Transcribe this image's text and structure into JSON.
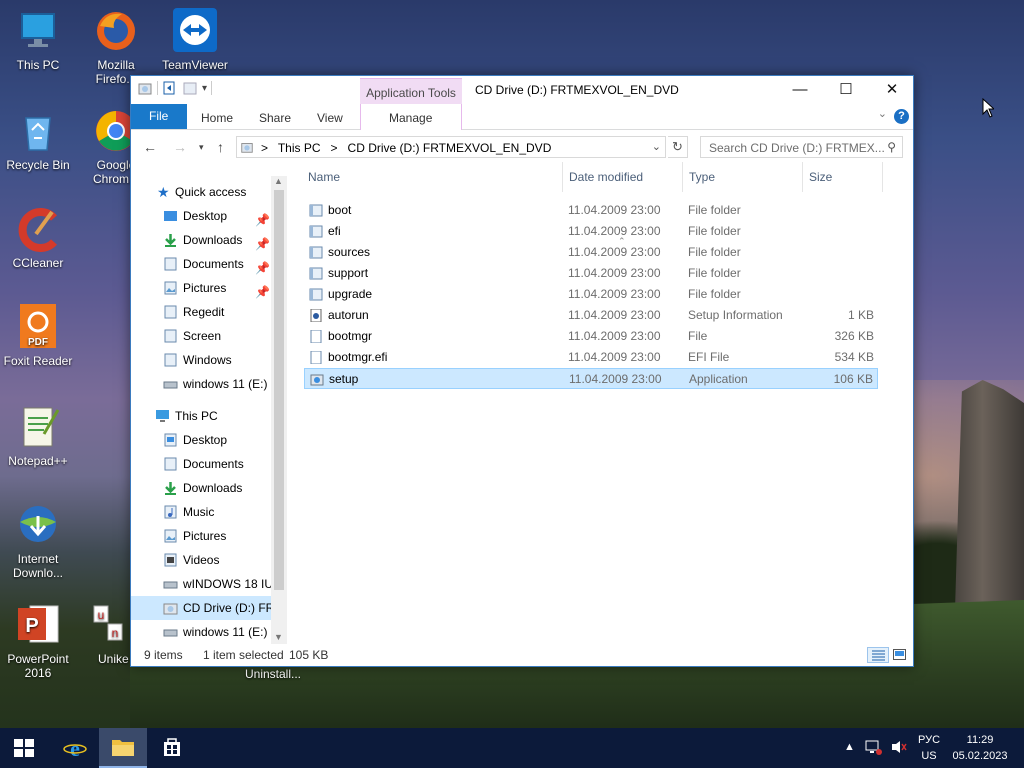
{
  "desktop": {
    "icons": [
      {
        "name": "this-pc",
        "label": "This PC"
      },
      {
        "name": "firefox",
        "label": "Mozilla Firefo..."
      },
      {
        "name": "teamviewer",
        "label": "TeamViewer"
      },
      {
        "name": "recycle-bin",
        "label": "Recycle Bin"
      },
      {
        "name": "chrome",
        "label": "Google Chrom..."
      },
      {
        "name": "ccleaner",
        "label": "CCleaner"
      },
      {
        "name": "foxit",
        "label": "Foxit Reader"
      },
      {
        "name": "notepadpp",
        "label": "Notepad++"
      },
      {
        "name": "idm",
        "label": "Internet Downlo..."
      },
      {
        "name": "powerpoint",
        "label": "PowerPoint 2016"
      },
      {
        "name": "unikey",
        "label": "Unike"
      },
      {
        "name": "uninstall",
        "label": "Uninstall..."
      }
    ]
  },
  "window": {
    "title": "CD Drive (D:) FRTMEXVOL_EN_DVD",
    "app_tools": "Application Tools",
    "tabs": {
      "file": "File",
      "home": "Home",
      "share": "Share",
      "view": "View",
      "manage": "Manage"
    },
    "address": {
      "path1": "This PC",
      "sep": ">",
      "path2": "CD Drive (D:) FRTMEXVOL_EN_DVD"
    },
    "search_placeholder": "Search CD Drive (D:) FRTMEX...",
    "columns": {
      "name": "Name",
      "date": "Date modified",
      "type": "Type",
      "size": "Size"
    },
    "nav": {
      "quick_access": "Quick access",
      "qa_items": [
        "Desktop",
        "Downloads",
        "Documents",
        "Pictures",
        "Regedit",
        "Screen",
        "Windows",
        "windows 11 (E:)"
      ],
      "this_pc": "This PC",
      "pc_items": [
        "Desktop",
        "Documents",
        "Downloads",
        "Music",
        "Pictures",
        "Videos",
        "wINDOWS 18 IU",
        "CD Drive (D:) FR",
        "windows 11 (E:)"
      ]
    },
    "files": [
      {
        "name": "boot",
        "date": "11.04.2009 23:00",
        "type": "File folder",
        "size": "",
        "kind": "folder"
      },
      {
        "name": "efi",
        "date": "11.04.2009 23:00",
        "type": "File folder",
        "size": "",
        "kind": "folder"
      },
      {
        "name": "sources",
        "date": "11.04.2009 23:00",
        "type": "File folder",
        "size": "",
        "kind": "folder"
      },
      {
        "name": "support",
        "date": "11.04.2009 23:00",
        "type": "File folder",
        "size": "",
        "kind": "folder"
      },
      {
        "name": "upgrade",
        "date": "11.04.2009 23:00",
        "type": "File folder",
        "size": "",
        "kind": "folder"
      },
      {
        "name": "autorun",
        "date": "11.04.2009 23:00",
        "type": "Setup Information",
        "size": "1 KB",
        "kind": "inf"
      },
      {
        "name": "bootmgr",
        "date": "11.04.2009 23:00",
        "type": "File",
        "size": "326 KB",
        "kind": "file"
      },
      {
        "name": "bootmgr.efi",
        "date": "11.04.2009 23:00",
        "type": "EFI File",
        "size": "534 KB",
        "kind": "file"
      },
      {
        "name": "setup",
        "date": "11.04.2009 23:00",
        "type": "Application",
        "size": "106 KB",
        "kind": "app",
        "selected": true
      }
    ],
    "status": {
      "count": "9 items",
      "selected": "1 item selected",
      "size": "105 KB"
    }
  },
  "taskbar": {
    "lang": "РУС",
    "lang_sub": "US",
    "time": "11:29",
    "date": "05.02.2023"
  },
  "colors": {
    "accent": "#1979ca",
    "selection": "#cce8ff",
    "taskbar": "#0c1a3a"
  }
}
